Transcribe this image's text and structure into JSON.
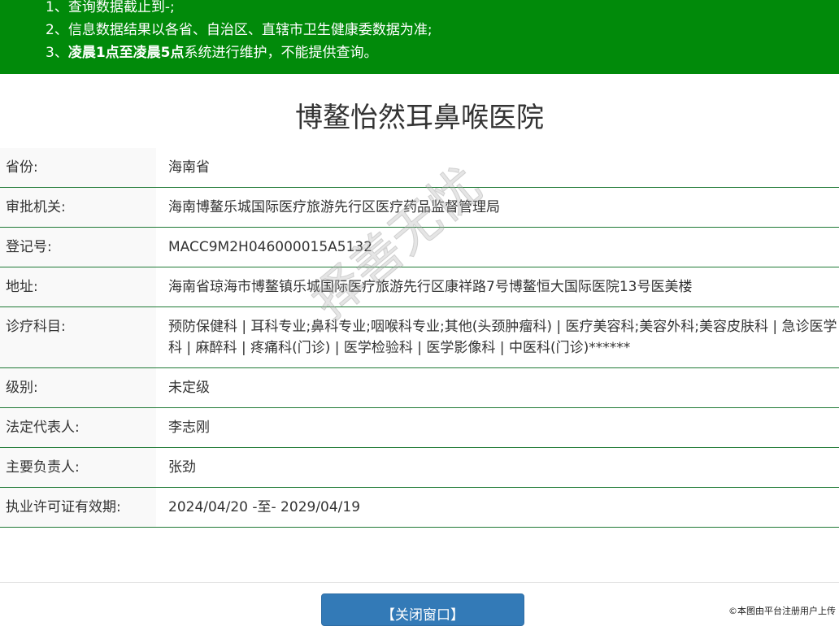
{
  "notice": {
    "line1": "1、查询数据截止到-;",
    "line2": "2、信息数据结果以各省、自治区、直辖市卫生健康委数据为准;",
    "line3_prefix": "3、",
    "line3_bold": "凌晨1点至凌晨5点",
    "line3_suffix": "系统进行维护，不能提供查询。",
    "background_color": "#018a0a"
  },
  "title": "博鳌怡然耳鼻喉医院",
  "rows": [
    {
      "label": "省份:",
      "value": "海南省"
    },
    {
      "label": "审批机关:",
      "value": "海南博鳌乐城国际医疗旅游先行区医疗药品监督管理局"
    },
    {
      "label": "登记号:",
      "value": "MACC9M2H046000015A5132"
    },
    {
      "label": "地址:",
      "value": "海南省琼海市博鳌镇乐城国际医疗旅游先行区康祥路7号博鳌恒大国际医院13号医美楼"
    },
    {
      "label": "诊疗科目:",
      "value": "预防保健科 | 耳科专业;鼻科专业;咽喉科专业;其他(头颈肿瘤科) | 医疗美容科;美容外科;美容皮肤科 | 急诊医学科 | 麻醉科 | 疼痛科(门诊) | 医学检验科 | 医学影像科 | 中医科(门诊)******"
    },
    {
      "label": "级别:",
      "value": "未定级"
    },
    {
      "label": "法定代表人:",
      "value": "李志刚"
    },
    {
      "label": "主要负责人:",
      "value": "张劲"
    },
    {
      "label": "执业许可证有效期:",
      "value": "2024/04/20 -至- 2029/04/19"
    }
  ],
  "close_button_label": "【关闭窗口】",
  "watermark": "择善无忧",
  "credit": "©本图由平台注册用户上传"
}
